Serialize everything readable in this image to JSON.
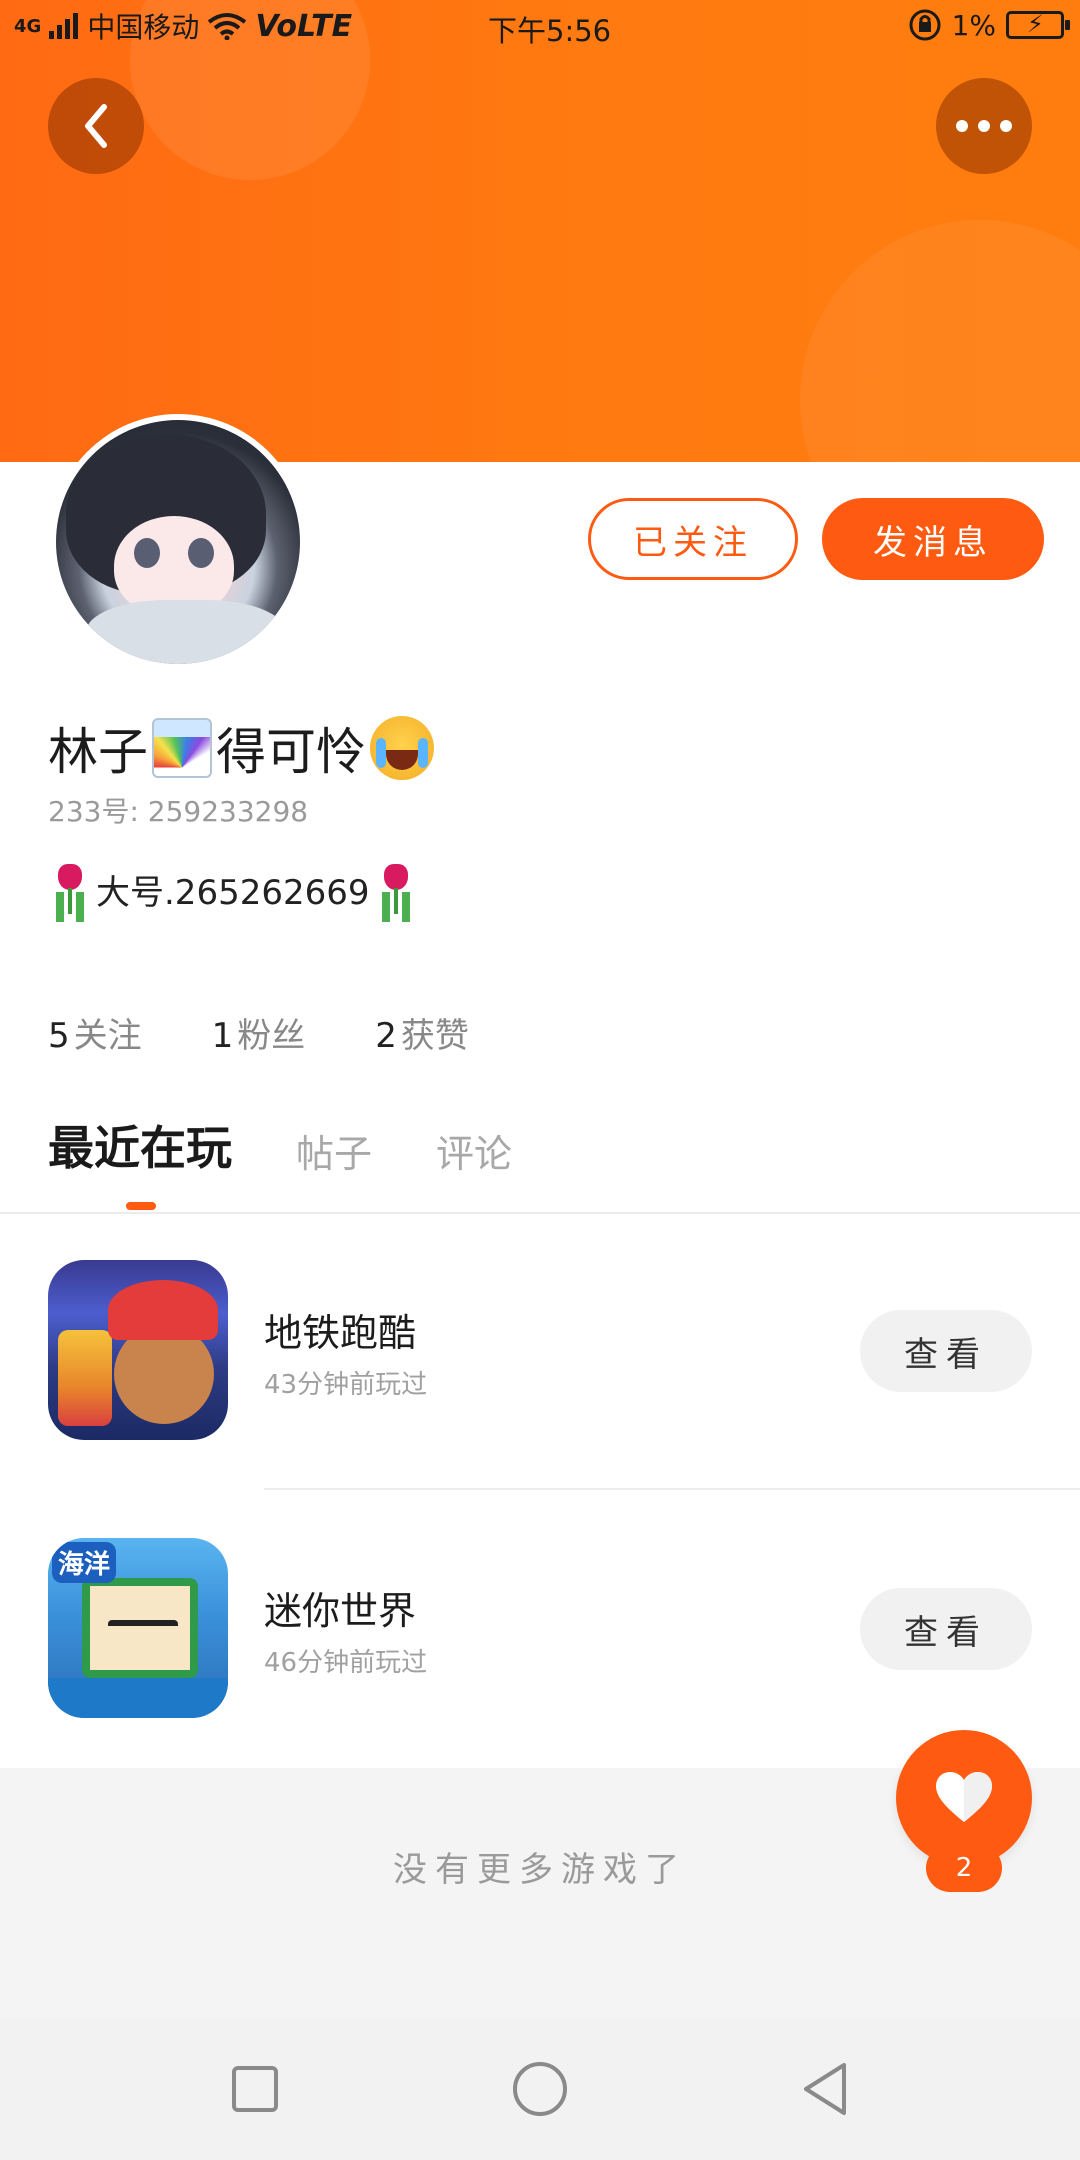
{
  "status_bar": {
    "network": "4G",
    "carrier": "中国移动",
    "volte": "VoLTE",
    "time": "下午5:56",
    "battery": "1%"
  },
  "header": {
    "back_icon": "chevron-left-icon",
    "more_icon": "more-dots-icon",
    "accent_color": "#ff6a13"
  },
  "profile": {
    "name_part1": "林子",
    "name_part2": "得可怜",
    "id_line": "233号: 259233298",
    "bio_text": "大号.265262669",
    "followed_label": "已关注",
    "message_label": "发消息"
  },
  "stats": [
    {
      "num": "5",
      "label": "关注"
    },
    {
      "num": "1",
      "label": "粉丝"
    },
    {
      "num": "2",
      "label": "获赞"
    }
  ],
  "tabs": [
    {
      "label": "最近在玩",
      "active": true
    },
    {
      "label": "帖子",
      "active": false
    },
    {
      "label": "评论",
      "active": false
    }
  ],
  "games": [
    {
      "title": "地铁跑酷",
      "subtitle": "43分钟前玩过",
      "button": "查看"
    },
    {
      "title": "迷你世界",
      "subtitle": "46分钟前玩过",
      "button": "查看",
      "icon_tag": "海洋"
    }
  ],
  "footer": {
    "no_more": "没有更多游戏了",
    "like_count": "2"
  }
}
